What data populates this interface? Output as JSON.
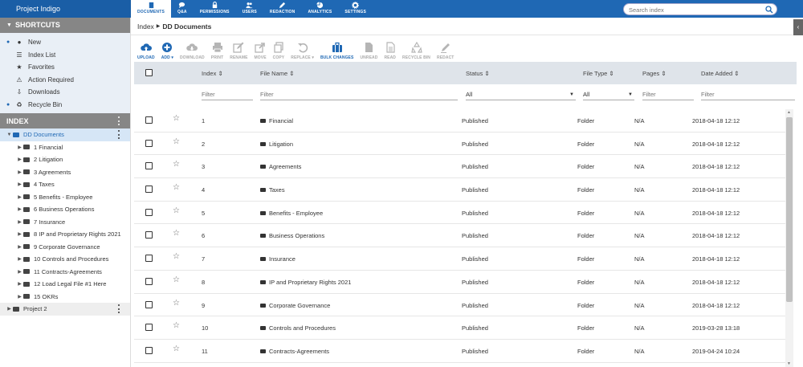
{
  "app": {
    "title": "Project Indigo"
  },
  "nav": {
    "tabs": [
      {
        "label": "DOCUMENTS",
        "icon": "document-icon",
        "active": true
      },
      {
        "label": "Q&A",
        "icon": "chat-icon",
        "active": false
      },
      {
        "label": "PERMISSIONS",
        "icon": "lock-icon",
        "active": false
      },
      {
        "label": "USERS",
        "icon": "users-icon",
        "active": false
      },
      {
        "label": "REDACTION",
        "icon": "pen-icon",
        "active": false
      },
      {
        "label": "ANALYTICS",
        "icon": "pie-chart-icon",
        "active": false
      },
      {
        "label": "SETTINGS",
        "icon": "gear-icon",
        "active": false
      }
    ],
    "search_placeholder": "Search index"
  },
  "sidebar": {
    "shortcuts_title": "SHORTCUTS",
    "shortcuts": [
      {
        "label": "New",
        "icon": "dot-icon",
        "bullet": true
      },
      {
        "label": "Index List",
        "icon": "list-icon",
        "bullet": false
      },
      {
        "label": "Favorites",
        "icon": "star-icon",
        "bullet": false
      },
      {
        "label": "Action Required",
        "icon": "exclamation-icon",
        "bullet": false
      },
      {
        "label": "Downloads",
        "icon": "download-icon",
        "bullet": false
      },
      {
        "label": "Recycle Bin",
        "icon": "recycle-icon",
        "bullet": true
      }
    ],
    "index_title": "INDEX",
    "tree": [
      {
        "label": "DD Documents",
        "level": 0,
        "expanded": true,
        "selected": true
      },
      {
        "label": "1 Financial",
        "level": 1
      },
      {
        "label": "2 Litigation",
        "level": 1
      },
      {
        "label": "3 Agreements",
        "level": 1
      },
      {
        "label": "4 Taxes",
        "level": 1
      },
      {
        "label": "5 Benefits - Employee",
        "level": 1
      },
      {
        "label": "6 Business Operations",
        "level": 1
      },
      {
        "label": "7 Insurance",
        "level": 1
      },
      {
        "label": "8 IP and Proprietary Rights 2021",
        "level": 1
      },
      {
        "label": "9 Corporate Governance",
        "level": 1
      },
      {
        "label": "10 Controls and Procedures",
        "level": 1
      },
      {
        "label": "11 Contracts-Agreements",
        "level": 1
      },
      {
        "label": "12 Load Legal File #1 Here",
        "level": 1
      },
      {
        "label": "15 OKRs",
        "level": 1
      },
      {
        "label": "Project 2",
        "level": 0,
        "expanded": false,
        "project": true
      }
    ]
  },
  "breadcrumb": {
    "root": "Index",
    "current": "DD Documents"
  },
  "toolbar": [
    {
      "label": "UPLOAD",
      "icon": "cloud-upload-icon",
      "enabled": true
    },
    {
      "label": "ADD",
      "icon": "add-circle-icon",
      "enabled": true,
      "dropdown": true
    },
    {
      "label": "DOWNLOAD",
      "icon": "cloud-download-icon",
      "enabled": false
    },
    {
      "label": "PRINT",
      "icon": "printer-icon",
      "enabled": false
    },
    {
      "label": "RENAME",
      "icon": "edit-icon",
      "enabled": false
    },
    {
      "label": "MOVE",
      "icon": "move-icon",
      "enabled": false
    },
    {
      "label": "COPY",
      "icon": "copy-icon",
      "enabled": false
    },
    {
      "label": "REPLACE",
      "icon": "undo-icon",
      "enabled": false,
      "dropdown": true
    },
    {
      "label": "BULK CHANGES",
      "icon": "briefcase-icon",
      "enabled": true
    },
    {
      "label": "UNREAD",
      "icon": "file-icon",
      "enabled": false
    },
    {
      "label": "READ",
      "icon": "file-text-icon",
      "enabled": false
    },
    {
      "label": "RECYCLE BIN",
      "icon": "recycle-icon",
      "enabled": false
    },
    {
      "label": "REDACT",
      "icon": "marker-icon",
      "enabled": false
    }
  ],
  "table": {
    "columns": [
      "Index",
      "File Name",
      "Status",
      "File Type",
      "Pages",
      "Date Added"
    ],
    "filter_placeholder": "Filter",
    "status_filter": "All",
    "type_filter": "All",
    "rows": [
      {
        "index": "1",
        "name": "Financial",
        "status": "Published",
        "type": "Folder",
        "pages": "N/A",
        "date": "2018-04-18 12:12"
      },
      {
        "index": "2",
        "name": "Litigation",
        "status": "Published",
        "type": "Folder",
        "pages": "N/A",
        "date": "2018-04-18 12:12"
      },
      {
        "index": "3",
        "name": "Agreements",
        "status": "Published",
        "type": "Folder",
        "pages": "N/A",
        "date": "2018-04-18 12:12"
      },
      {
        "index": "4",
        "name": "Taxes",
        "status": "Published",
        "type": "Folder",
        "pages": "N/A",
        "date": "2018-04-18 12:12"
      },
      {
        "index": "5",
        "name": "Benefits - Employee",
        "status": "Published",
        "type": "Folder",
        "pages": "N/A",
        "date": "2018-04-18 12:12"
      },
      {
        "index": "6",
        "name": "Business Operations",
        "status": "Published",
        "type": "Folder",
        "pages": "N/A",
        "date": "2018-04-18 12:12"
      },
      {
        "index": "7",
        "name": "Insurance",
        "status": "Published",
        "type": "Folder",
        "pages": "N/A",
        "date": "2018-04-18 12:12"
      },
      {
        "index": "8",
        "name": "IP and Proprietary Rights 2021",
        "status": "Published",
        "type": "Folder",
        "pages": "N/A",
        "date": "2018-04-18 12:12"
      },
      {
        "index": "9",
        "name": "Corporate Governance",
        "status": "Published",
        "type": "Folder",
        "pages": "N/A",
        "date": "2018-04-18 12:12"
      },
      {
        "index": "10",
        "name": "Controls and Procedures",
        "status": "Published",
        "type": "Folder",
        "pages": "N/A",
        "date": "2019-03-28 13:18"
      },
      {
        "index": "11",
        "name": "Contracts-Agreements",
        "status": "Published",
        "type": "Folder",
        "pages": "N/A",
        "date": "2019-04-24 10:24"
      }
    ]
  },
  "colors": {
    "brand": "#1f68b4",
    "section_header": "#868686",
    "selected": "#d6e6f6"
  }
}
